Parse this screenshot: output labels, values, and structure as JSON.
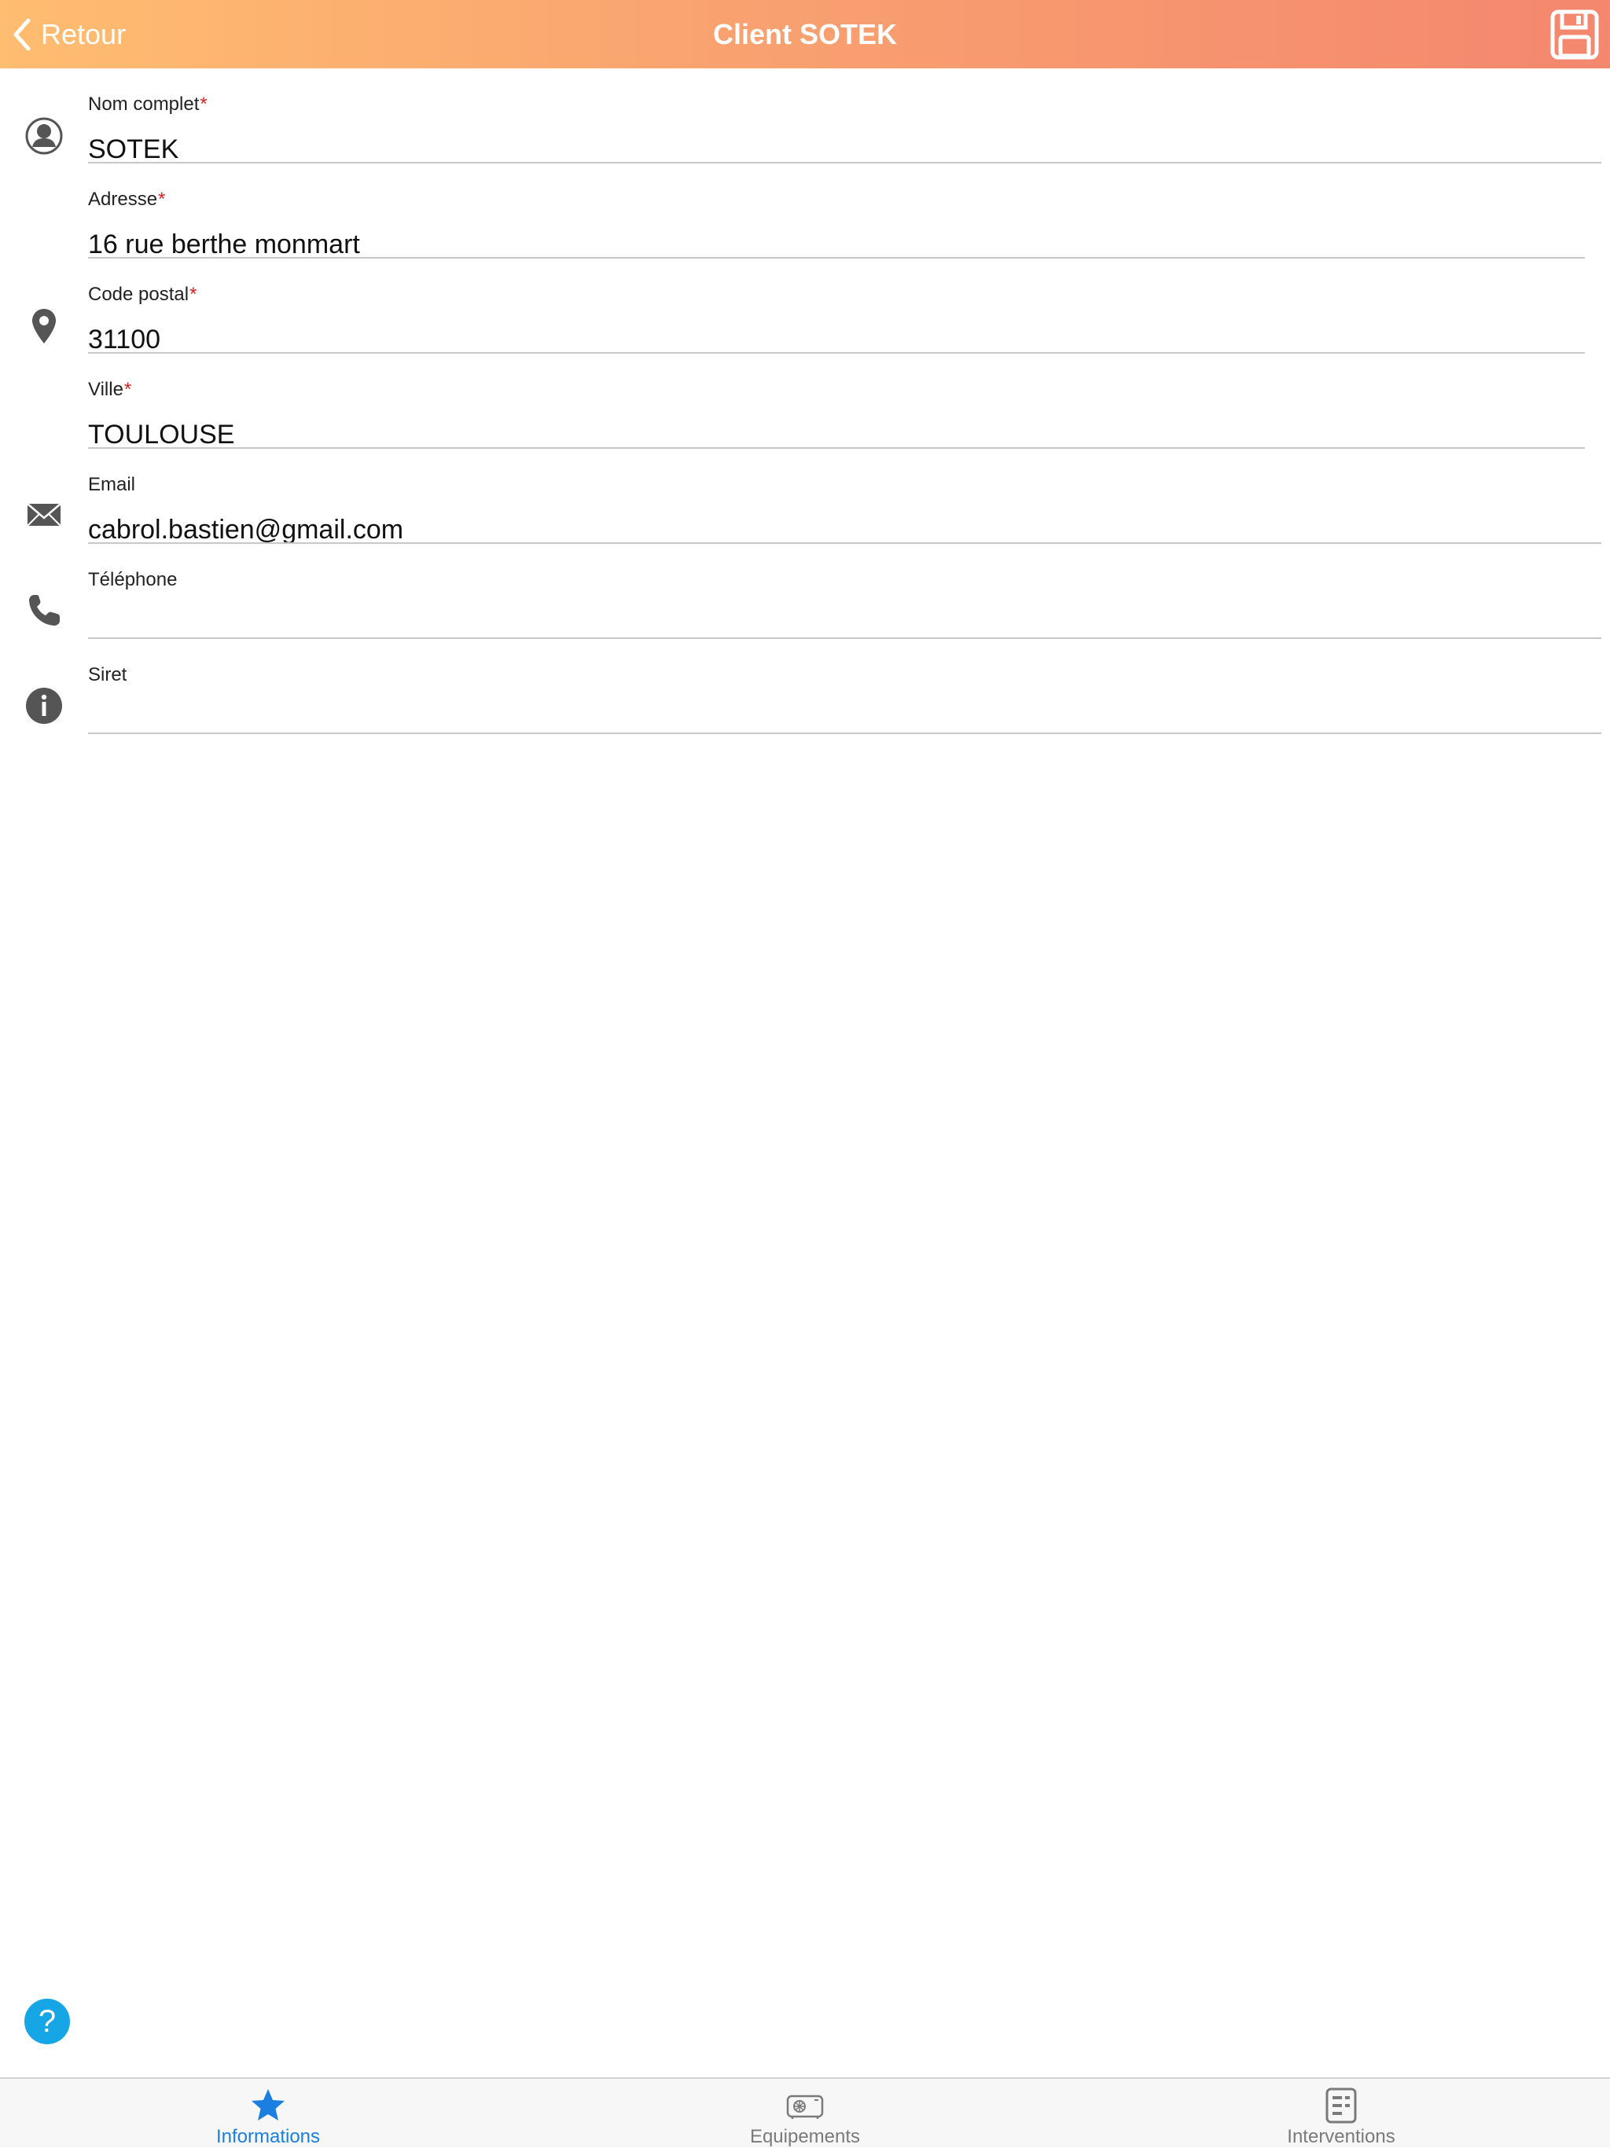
{
  "header": {
    "back_label": "Retour",
    "title": "Client SOTEK",
    "gradient_start": "#ffbd70",
    "gradient_end": "#f4876e"
  },
  "form": {
    "fields": [
      {
        "label": "Nom complet",
        "required_mark": "*",
        "value": "SOTEK",
        "icon": "person-icon"
      },
      {
        "label": "Adresse",
        "required_mark": "*",
        "value": "16 rue berthe monmart",
        "icon": "location-pin-icon"
      },
      {
        "label": "Code postal",
        "required_mark": "*",
        "value": "31100"
      },
      {
        "label": "Ville",
        "required_mark": "*",
        "value": "TOULOUSE"
      },
      {
        "label": "Email",
        "value": "cabrol.bastien@gmail.com",
        "icon": "envelope-icon"
      },
      {
        "label": "Téléphone",
        "value": "",
        "icon": "phone-icon"
      },
      {
        "label": "Siret",
        "value": "",
        "icon": "info-icon"
      }
    ]
  },
  "help": {
    "glyph": "?",
    "color": "#16a6e6"
  },
  "tabs": [
    {
      "label": "Informations",
      "icon": "star-icon",
      "active": true
    },
    {
      "label": "Equipements",
      "icon": "equipment-icon",
      "active": false
    },
    {
      "label": "Interventions",
      "icon": "document-list-icon",
      "active": false
    }
  ],
  "colors": {
    "active_tab": "#1a7fe0",
    "inactive_tab": "#7a7a7a",
    "required": "#e02020",
    "icon": "#555555"
  }
}
